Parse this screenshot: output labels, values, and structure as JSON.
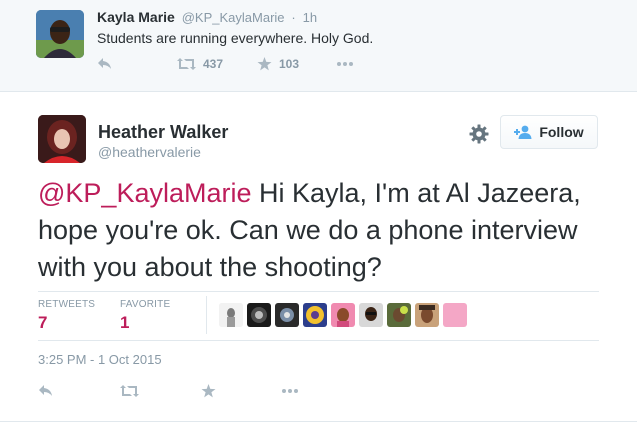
{
  "context_tweet": {
    "name": "Kayla Marie",
    "handle": "@KP_KaylaMarie",
    "separator": "·",
    "time": "1h",
    "text": "Students are running everywhere. Holy God.",
    "retweets": "437",
    "favorites": "103",
    "avatar_icon": "user-avatar-photo"
  },
  "tweet": {
    "name": "Heather Walker",
    "handle": "@heathervalerie",
    "mention": "@KP_KaylaMarie",
    "text": " Hi Kayla, I'm at Al Jazeera, hope you're ok. Can we do a phone interview with you about the shooting?",
    "follow_label": "Follow",
    "stats": {
      "retweets_label": "RETWEETS",
      "retweets_value": "7",
      "favorites_label": "FAVORITE",
      "favorites_value": "1"
    },
    "timestamp": "3:25 PM - 1 Oct 2015",
    "favoriter_avatar_count": 8
  },
  "colors": {
    "accent": "#bd1d5a",
    "muted": "#8899a6",
    "action_icon": "#aab8c2",
    "text": "#292f33",
    "context_bg": "#f5f8fa"
  }
}
